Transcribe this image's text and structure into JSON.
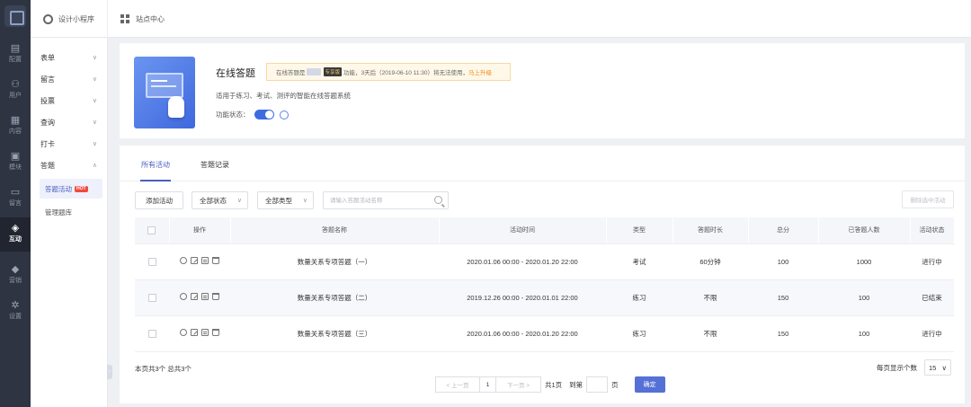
{
  "topbar": {
    "mini_program": "设计小程序",
    "site_center": "站点中心"
  },
  "rail": {
    "items": [
      {
        "label": "配置",
        "icon": "config-icon"
      },
      {
        "label": "用户",
        "icon": "user-icon"
      },
      {
        "label": "内容",
        "icon": "content-icon"
      },
      {
        "label": "模块",
        "icon": "module-icon"
      },
      {
        "label": "留言",
        "icon": "message-icon"
      },
      {
        "label": "互动",
        "icon": "gamepad-icon",
        "active": true
      },
      {
        "label": "营销",
        "icon": "tag-icon"
      },
      {
        "label": "设置",
        "icon": "settings-icon"
      }
    ]
  },
  "sidebar": {
    "items": [
      {
        "label": "表单",
        "arrow": "∨"
      },
      {
        "label": "留言",
        "arrow": "∨"
      },
      {
        "label": "投票",
        "arrow": "∨"
      },
      {
        "label": "查询",
        "arrow": "∨"
      },
      {
        "label": "打卡",
        "arrow": "∨"
      },
      {
        "label": "答题",
        "arrow": "∧"
      }
    ],
    "sub_items": [
      {
        "label": "答题活动",
        "badge": "HOT",
        "active": true
      },
      {
        "label": "管理题库"
      }
    ]
  },
  "app": {
    "title": "在线答题",
    "notice_prefix": "在线答题是",
    "notice_pro": "专享版",
    "notice_suffix": "功能，3天后（2019-06-10 11:30）将无法使用，",
    "notice_upgrade": "马上升级",
    "description": "适用于练习、考试、测评的智能在线答题系统",
    "status_label": "功能状态："
  },
  "tabs": [
    {
      "label": "所有活动",
      "active": true
    },
    {
      "label": "答题记录"
    }
  ],
  "toolbar": {
    "add_label": "添加活动",
    "status_select": "全部状态",
    "type_select": "全部类型",
    "search_placeholder": "请输入答题活动名称",
    "delete_selected": "删除选中活动"
  },
  "table": {
    "headers": [
      "操作",
      "答题名称",
      "活动时间",
      "类型",
      "答题时长",
      "总分",
      "已答题人数",
      "活动状态"
    ],
    "rows": [
      {
        "name": "数量关系专项答题（一）",
        "time": "2020.01.06 00:00 - 2020.01.20 22:00",
        "type": "考试",
        "duration": "60分钟",
        "score": "100",
        "count": "1000",
        "status": "进行中"
      },
      {
        "name": "数量关系专项答题（二）",
        "time": "2019.12.26 00:00 - 2020.01.01 22:00",
        "type": "练习",
        "duration": "不限",
        "score": "150",
        "count": "100",
        "status": "已结束"
      },
      {
        "name": "数量关系专项答题（三）",
        "time": "2020.01.06 00:00 - 2020.01.20 22:00",
        "type": "练习",
        "duration": "不限",
        "score": "150",
        "count": "100",
        "status": "进行中"
      }
    ]
  },
  "pagination": {
    "info": "本页共3个  总共3个",
    "prev": "< 上一页",
    "current": "1",
    "next": "下一页 >",
    "total_pages": "共1页",
    "goto": "到第",
    "page_unit": "页",
    "confirm": "确定",
    "per_page_label": "每页显示个数",
    "per_page_value": "15"
  },
  "colors": {
    "accent": "#4a5fc1",
    "primary_button": "#5570d6",
    "rail_bg": "#2e3442",
    "hot_badge": "#f04a3c",
    "upgrade_link": "#f08a1c"
  }
}
